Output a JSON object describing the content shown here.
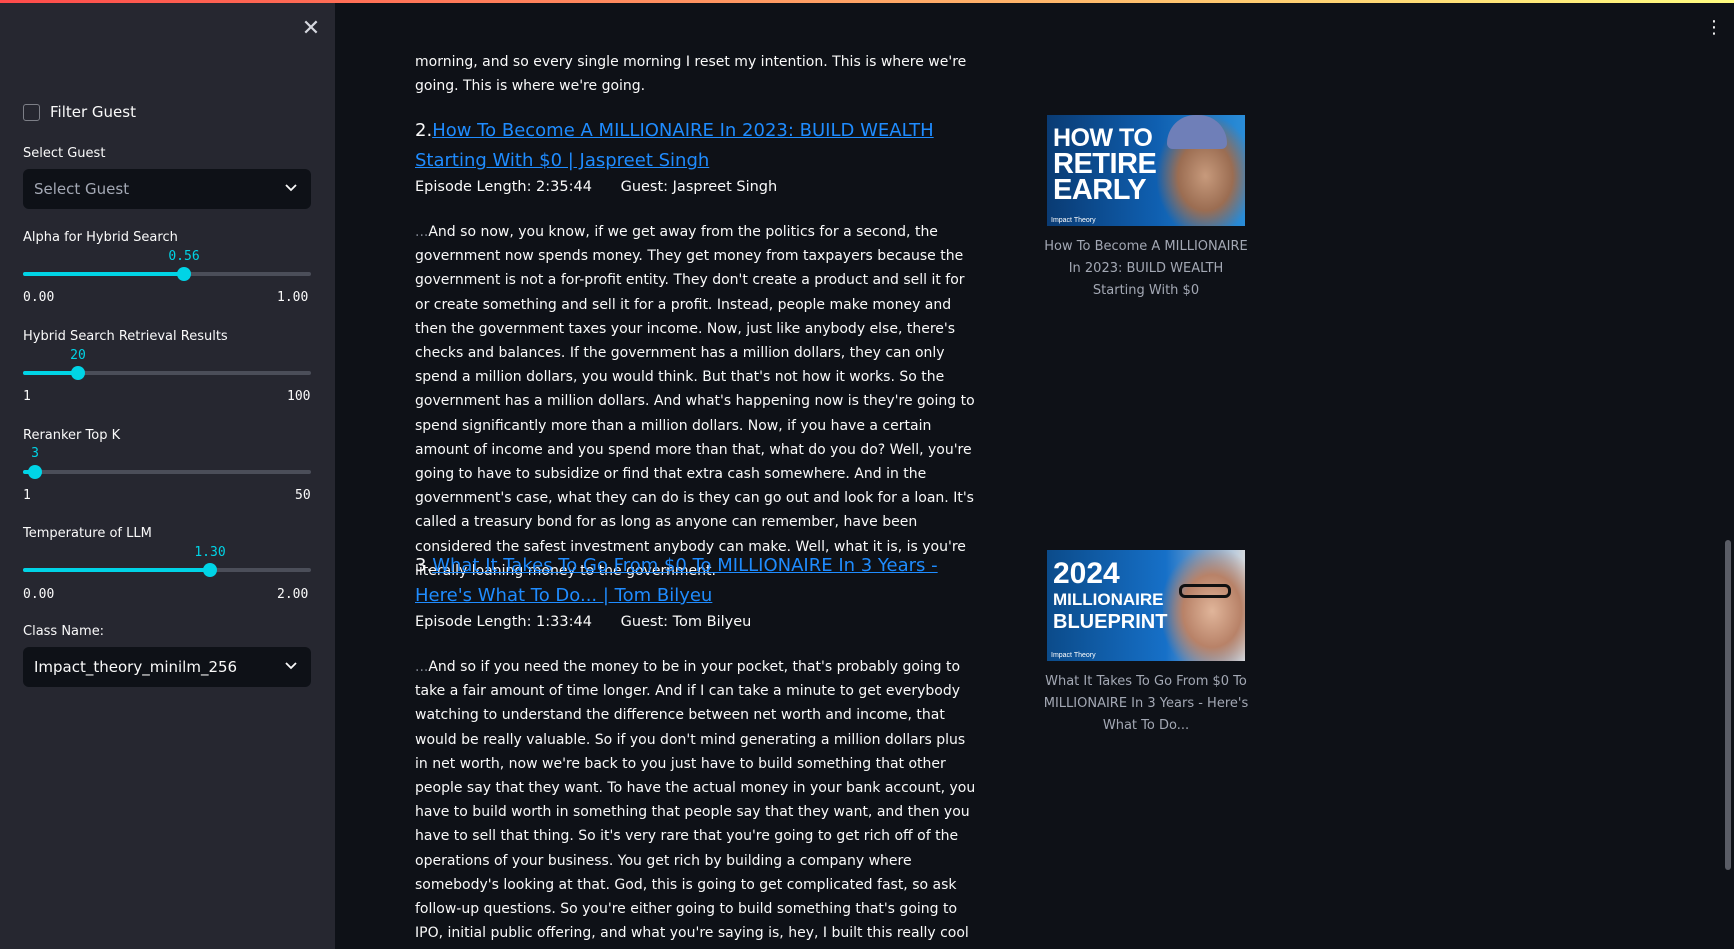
{
  "sidebar": {
    "close_glyph": "✕",
    "filter_guest": {
      "label": "Filter Guest",
      "checked": false
    },
    "select_guest": {
      "label": "Select Guest",
      "placeholder": "Select Guest"
    },
    "alpha": {
      "label": "Alpha for Hybrid Search",
      "value": "0.56",
      "min": "0.00",
      "max": "1.00",
      "fraction": 0.56
    },
    "retrieval": {
      "label": "Hybrid Search Retrieval Results",
      "value": "20",
      "min": "1",
      "max": "100",
      "fraction": 0.192
    },
    "reranker": {
      "label": "Reranker Top K",
      "value": "3",
      "min": "1",
      "max": "50",
      "fraction": 0.04
    },
    "temperature": {
      "label": "Temperature of LLM",
      "value": "1.30",
      "min": "0.00",
      "max": "2.00",
      "fraction": 0.65
    },
    "class_name": {
      "label": "Class Name:",
      "value": "Impact_theory_minilm_256"
    }
  },
  "main": {
    "menu_glyph": "⋮",
    "prev_tail": "morning, and so every single morning I reset my intention. This is where we're going. This is where we're going.",
    "results": [
      {
        "number": "2.",
        "title": "How To Become A MILLIONAIRE In 2023: BUILD WEALTH Starting With $0 | Jaspreet Singh",
        "episode_length": "Episode Length: 2:35:44",
        "guest": "Guest: Jaspreet Singh",
        "ellipsis": "...",
        "text": "And so now, you know, if we get away from the politics for a second, the government now spends money. They get money from taxpayers because the government is not a for-profit entity. They don't create a product and sell it for or create something and sell it for a profit. Instead, people make money and then the government taxes your income. Now, just like anybody else, there's checks and balances. If the government has a million dollars, they can only spend a million dollars, you would think. But that's not how it works. So the government has a million dollars. And what's happening now is they're going to spend significantly more than a million dollars. Now, if you have a certain amount of income and you spend more than that, what do you do? Well, you're going to have to subsidize or find that extra cash somewhere. And in the government's case, what they can do is they can go out and look for a loan. It's called a treasury bond for as long as anyone can remember, have been considered the safest investment anybody can make. Well, what it is, is you're literally loaning money to the government.",
        "thumbnail": {
          "line1": "HOW TO",
          "line2": "RETIRE",
          "line3": "EARLY",
          "brand": "Impact Theory"
        },
        "caption": "How To Become A MILLIONAIRE In 2023: BUILD WEALTH Starting With $0"
      },
      {
        "number": "3.",
        "title": "What It Takes To Go From $0 To MILLIONAIRE In 3 Years - Here's What To Do... | Tom Bilyeu",
        "episode_length": "Episode Length: 1:33:44",
        "guest": "Guest: Tom Bilyeu",
        "ellipsis": "...",
        "text": "And so if you need the money to be in your pocket, that's probably going to take a fair amount of time longer. And if I can take a minute to get everybody watching to understand the difference between net worth and income, that would be really valuable. So if you don't mind generating a million dollars plus in net worth, now we're back to you just have to build something that other people say that they want. To have the actual money in your bank account, you have to build worth in something that people say that they want, and then you have to sell that thing. So it's very rare that you're going to get rich off of the operations of your business. You get rich by building a company where somebody's looking at that. God, this is going to get complicated fast, so ask follow-up questions. So you're either going to build something that's going to IPO, initial public offering, and what you're saying is, hey, I built this really cool thing. It makes a lot of money, or people think it's going to make a lot of money.",
        "thumbnail": {
          "line1": "2024",
          "line2": "MILLIONAIRE",
          "line3": "BLUEPRINT",
          "brand": "Impact Theory"
        },
        "caption": "What It Takes To Go From $0 To MILLIONAIRE In 3 Years - Here's What To Do..."
      }
    ]
  },
  "colors": {
    "accent": "#00d4e6",
    "link": "#1f8cff",
    "sidebar_bg": "#262730",
    "main_bg": "#0e1117"
  }
}
